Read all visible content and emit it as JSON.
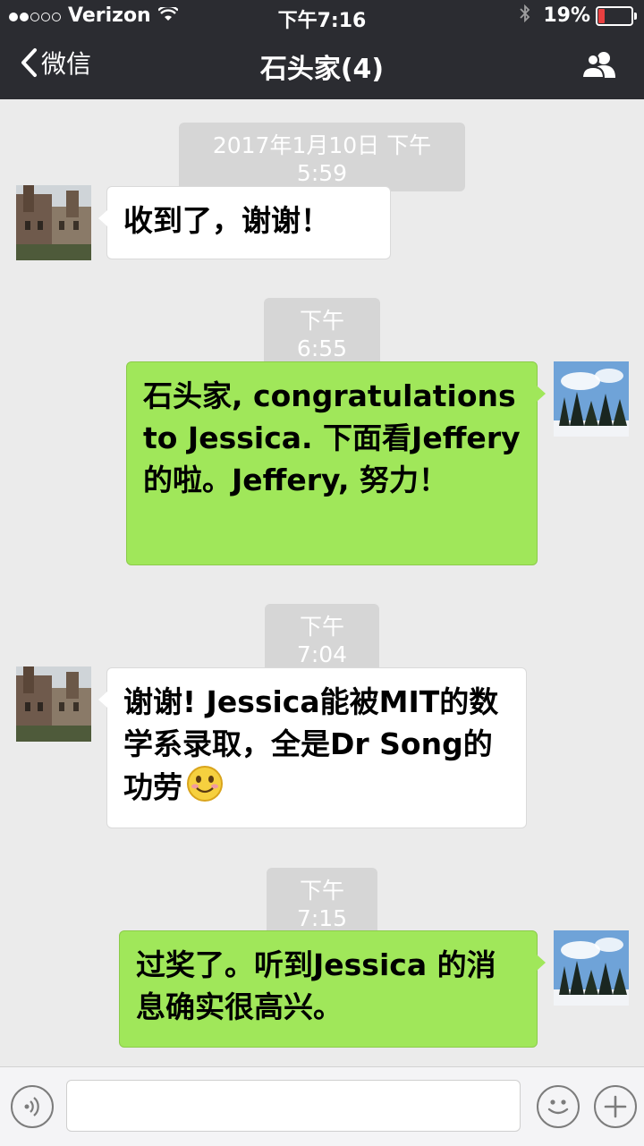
{
  "status_bar": {
    "carrier": "Verizon",
    "signal_bars_filled": 2,
    "signal_bars_total": 5,
    "time": "下午7:16",
    "battery_text": "19%",
    "battery_level": 0.19,
    "battery_color": "#e84040"
  },
  "nav": {
    "back_label": "微信",
    "title": "石头家(4)"
  },
  "messages": [
    {
      "stamp": "2017年1月10日 下午5:59"
    },
    {
      "side": "left",
      "text": "收到了，谢谢！"
    },
    {
      "stamp": "下午6:55"
    },
    {
      "side": "right",
      "text": "石头家, congratulations to Jessica. 下面看Jeffery 的啦。Jeffery, 努力！"
    },
    {
      "stamp": "下午7:04"
    },
    {
      "side": "left",
      "text": "谢谢! Jessica能被MIT的数学系录取，全是Dr Song的功劳",
      "emoji": "smile-emoji"
    },
    {
      "stamp": "下午7:15"
    },
    {
      "side": "right",
      "text": "过奖了。听到Jessica 的消息确实很高兴。"
    }
  ],
  "icons": {
    "back": "chevron-left-icon",
    "group": "group-members-icon",
    "voice": "voice-icon",
    "emoji": "emoji-icon",
    "add": "plus-icon"
  },
  "colors": {
    "topbar": "#2b2c31",
    "chat_bg": "#ebebeb",
    "bubble_sent": "#a0e75a",
    "bubble_received": "#ffffff",
    "stamp_bg": "#d6d6d6"
  }
}
